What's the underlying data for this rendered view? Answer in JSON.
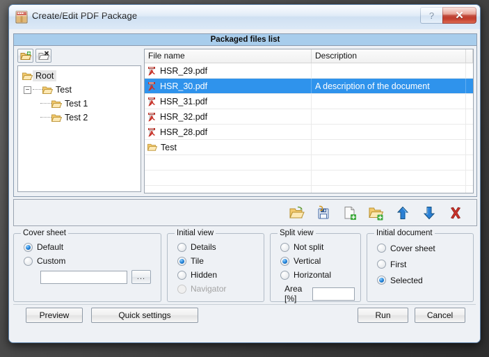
{
  "window": {
    "title": "Create/Edit PDF Package",
    "icon": "pdf-package-icon",
    "help_label": "?",
    "close_label": "✕"
  },
  "files_group": {
    "title": "Packaged files list",
    "tree_toolbar": [
      {
        "name": "add-folder-button",
        "tooltip": "Add folder"
      },
      {
        "name": "remove-folder-button",
        "tooltip": "Remove folder"
      }
    ],
    "tree": [
      {
        "label": "Root",
        "level": 0,
        "selected": true,
        "expander": "none"
      },
      {
        "label": "Test",
        "level": 1,
        "selected": false,
        "expander": "minus"
      },
      {
        "label": "Test 1",
        "level": 2,
        "selected": false,
        "expander": "none"
      },
      {
        "label": "Test 2",
        "level": 2,
        "selected": false,
        "expander": "none"
      }
    ],
    "columns": {
      "name": "File name",
      "description": "Description"
    },
    "rows": [
      {
        "icon": "pdf-icon",
        "name": "HSR_29.pdf",
        "description": "",
        "selected": false
      },
      {
        "icon": "pdf-icon",
        "name": "HSR_30.pdf",
        "description": "A description of the document",
        "selected": true
      },
      {
        "icon": "pdf-icon",
        "name": "HSR_31.pdf",
        "description": "",
        "selected": false
      },
      {
        "icon": "pdf-icon",
        "name": "HSR_32.pdf",
        "description": "",
        "selected": false
      },
      {
        "icon": "pdf-icon",
        "name": "HSR_28.pdf",
        "description": "",
        "selected": false
      },
      {
        "icon": "folder-icon",
        "name": "Test",
        "description": "",
        "selected": false
      }
    ],
    "empty_rows": 4
  },
  "icon_toolbar": [
    {
      "name": "open-package-icon",
      "tooltip": "Open package"
    },
    {
      "name": "save-package-icon",
      "tooltip": "Save package"
    },
    {
      "name": "add-document-icon",
      "tooltip": "Add document"
    },
    {
      "name": "add-folder-icon",
      "tooltip": "Add folder"
    },
    {
      "name": "move-up-icon",
      "tooltip": "Move up"
    },
    {
      "name": "move-down-icon",
      "tooltip": "Move down"
    },
    {
      "name": "delete-icon",
      "tooltip": "Delete"
    }
  ],
  "options": {
    "cover_sheet": {
      "legend": "Cover sheet",
      "items": [
        {
          "label": "Default",
          "selected": true,
          "disabled": false
        },
        {
          "label": "Custom",
          "selected": false,
          "disabled": false
        }
      ],
      "path_value": "",
      "path_placeholder": "",
      "browse_label": "..."
    },
    "initial_view": {
      "legend": "Initial view",
      "items": [
        {
          "label": "Details",
          "selected": false,
          "disabled": false
        },
        {
          "label": "Tile",
          "selected": true,
          "disabled": false
        },
        {
          "label": "Hidden",
          "selected": false,
          "disabled": false
        },
        {
          "label": "Navigator",
          "selected": false,
          "disabled": true
        }
      ]
    },
    "split_view": {
      "legend": "Split view",
      "items": [
        {
          "label": "Not split",
          "selected": false,
          "disabled": false
        },
        {
          "label": "Vertical",
          "selected": true,
          "disabled": false
        },
        {
          "label": "Horizontal",
          "selected": false,
          "disabled": false
        }
      ],
      "area_label": "Area [%]",
      "area_value": ""
    },
    "initial_document": {
      "legend": "Initial document",
      "items": [
        {
          "label": "Cover sheet",
          "selected": false,
          "disabled": false
        },
        {
          "label": "First",
          "selected": false,
          "disabled": false
        },
        {
          "label": "Selected",
          "selected": true,
          "disabled": false
        }
      ]
    }
  },
  "footer": {
    "preview": "Preview",
    "quick_settings": "Quick settings",
    "run": "Run",
    "cancel": "Cancel"
  },
  "colors": {
    "selection_blue": "#2f93ec",
    "group_header_blue": "#a8cdec",
    "close_red": "#bc3c2c",
    "dialog_bg": "#eef1f5"
  }
}
